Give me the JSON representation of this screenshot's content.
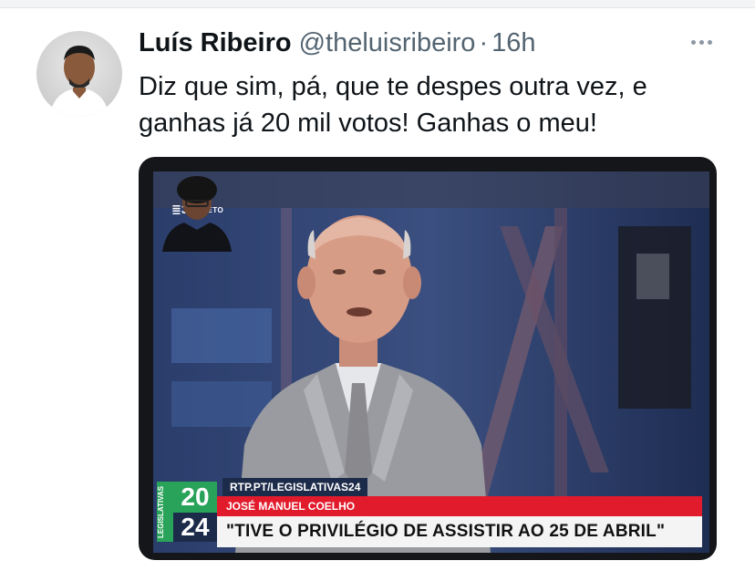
{
  "tweet": {
    "author_name": "Luís Ribeiro",
    "handle": "@theluisribeiro",
    "separator": "·",
    "time": "16h",
    "text": "Diz que sim, pá, que te despes outra vez, e ganhas já 20 mil votos! Ganhas o meu!"
  },
  "media": {
    "channel_logo": "≣3",
    "live_label": "DIRETO",
    "election_vertical": "LEGISLATIVAS",
    "election_year_top": "20",
    "election_year_bottom": "24",
    "url": "RTP.PT/LEGISLATIVAS24",
    "speaker": "JOSÉ MANUEL COELHO",
    "quote": "\"TIVE O PRIVILÉGIO DE ASSISTIR AO 25 DE ABRIL\""
  },
  "icons": [
    "avatar",
    "more-options-icon"
  ],
  "colors": {
    "name": "#0f1419",
    "secondary": "#536471",
    "ticker_red": "#e21b2c",
    "logo_green": "#2aa35a",
    "navy": "#1d2b4a"
  }
}
